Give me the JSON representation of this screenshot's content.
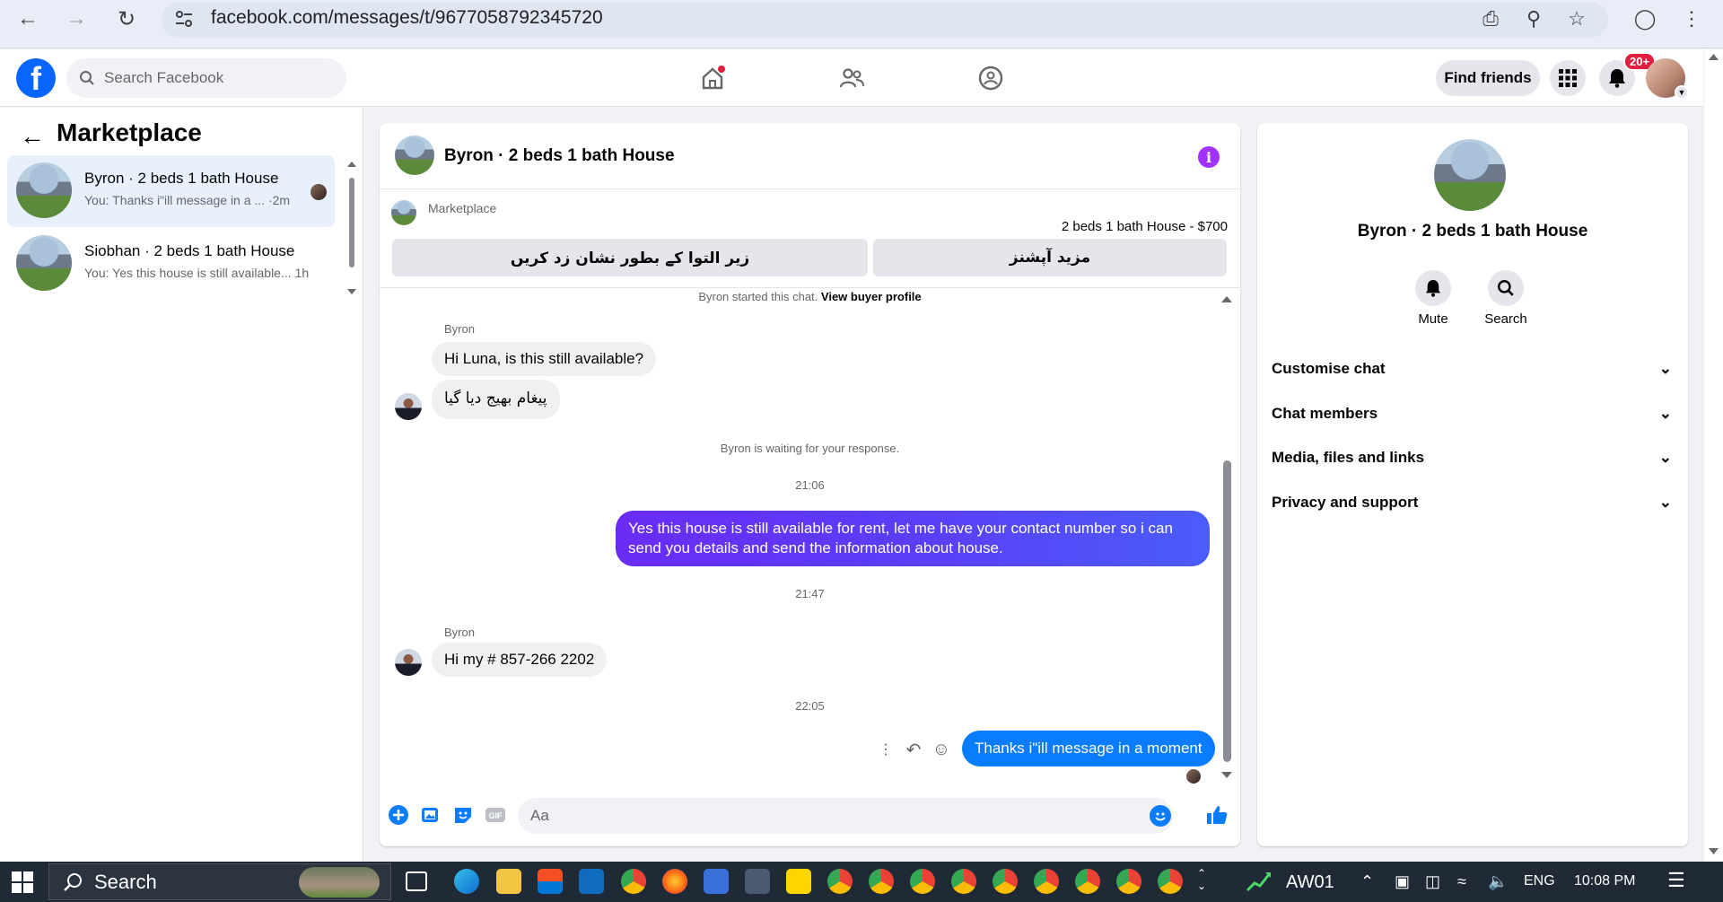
{
  "browser": {
    "url": "facebook.com/messages/t/9677058792345720"
  },
  "header": {
    "search_placeholder": "Search Facebook",
    "find_friends": "Find friends",
    "notifications_badge": "20+",
    "brand_color": "#0866ff"
  },
  "sidebar": {
    "title": "Marketplace",
    "conversations": [
      {
        "name": "Byron · 2 beds 1 bath House",
        "snippet": "You: Thanks i\"ill message in a ...",
        "time": "·2m",
        "active": true
      },
      {
        "name": "Siobhan · 2 beds 1 bath House",
        "snippet": "You: Yes this house is still available...",
        "time": "1h",
        "active": false
      }
    ]
  },
  "chat": {
    "title": "Byron · 2 beds 1 bath House",
    "marketplace_label": "Marketplace",
    "listing": "2 beds 1 bath House - $700",
    "btn_mark_pending": "زیر التوا کے بطور نشان زد کریں",
    "btn_more_options": "مزید آپشنز",
    "started_text": "Byron started this chat.",
    "view_profile": "View buyer profile",
    "sender1": "Byron",
    "msg1": "Hi Luna, is this still available?",
    "msg2": "پیغام بھیج دیا گیا",
    "waiting": "Byron is waiting for your response.",
    "time1": "21:06",
    "msg3": "Yes this house is still available for rent, let me have your contact number so i can send you details and send the information about house.",
    "time2": "21:47",
    "sender2": "Byron",
    "msg4": "Hi my # 857-266 2202",
    "time3": "22:05",
    "msg5": "Thanks i\"ill message in a moment",
    "composer_placeholder": "Aa",
    "accent": "#5a3ef8"
  },
  "details": {
    "name": "Byron · 2 beds 1 bath House",
    "mute": "Mute",
    "search": "Search",
    "sections": [
      "Customise chat",
      "Chat members",
      "Media, files and links",
      "Privacy and support"
    ]
  },
  "taskbar": {
    "search": "Search",
    "stock": "AW01",
    "lang": "ENG",
    "time": "10:08 PM"
  }
}
